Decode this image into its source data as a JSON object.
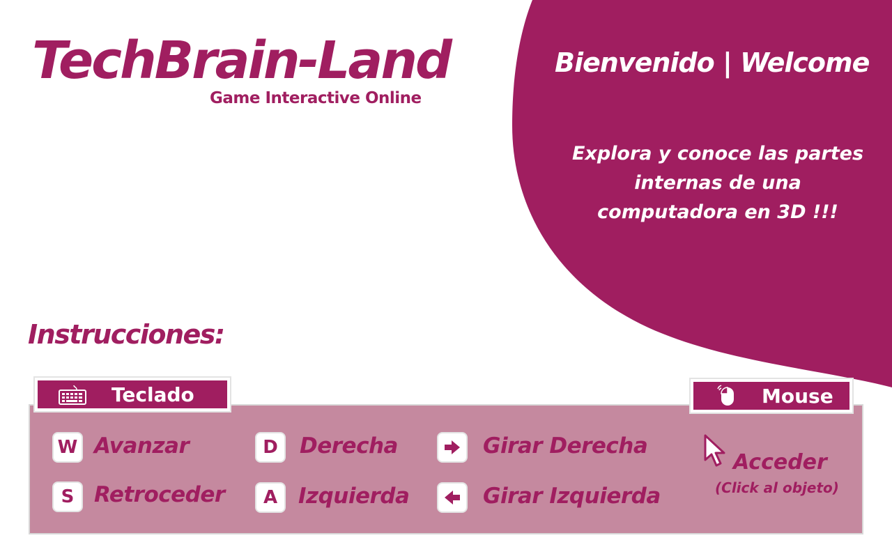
{
  "brand": {
    "title": "TechBrain-Land",
    "subtitle": "Game Interactive Online"
  },
  "hero": {
    "welcome": "Bienvenido | Welcome",
    "intro_line1": "Explora y conoce las partes",
    "intro_line2": "internas de una",
    "intro_line3": "computadora en 3D !!!"
  },
  "instructions": {
    "title": "Instrucciones:",
    "keyboard_tab": "Teclado",
    "mouse_tab": "Mouse",
    "keys": [
      {
        "key": "W",
        "action": "Avanzar"
      },
      {
        "key": "S",
        "action": "Retroceder"
      },
      {
        "key": "D",
        "action": "Derecha"
      },
      {
        "key": "A",
        "action": "Izquierda"
      },
      {
        "key": "arrow-right-icon",
        "action": "Girar Derecha"
      },
      {
        "key": "arrow-left-icon",
        "action": "Girar Izquierda"
      }
    ],
    "mouse": {
      "action": "Acceder",
      "hint": "(Click al objeto)"
    }
  },
  "colors": {
    "brand": "#a01e60",
    "panel": "#c5899f",
    "text_light": "#ffffff"
  }
}
